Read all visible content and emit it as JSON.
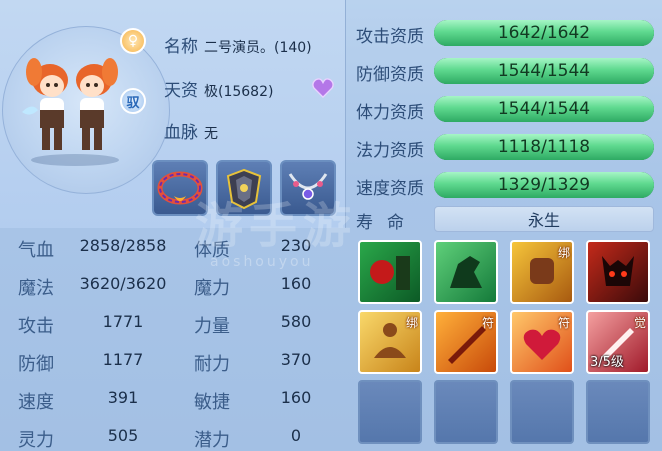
{
  "pet": {
    "name_label": "名称",
    "name_value": "二号演员。(140)",
    "talent_label": "天资",
    "talent_value": "极(15682)",
    "bloodline_label": "血脉",
    "bloodline_value": "无",
    "gender_badge": "♀",
    "tame_badge": "驭"
  },
  "stats": [
    {
      "label": "气血",
      "value": "2858/2858",
      "label2": "体质",
      "value2": "230"
    },
    {
      "label": "魔法",
      "value": "3620/3620",
      "label2": "魔力",
      "value2": "160"
    },
    {
      "label": "攻击",
      "value": "1771",
      "label2": "力量",
      "value2": "580"
    },
    {
      "label": "防御",
      "value": "1177",
      "label2": "耐力",
      "value2": "370"
    },
    {
      "label": "速度",
      "value": "391",
      "label2": "敏捷",
      "value2": "160"
    },
    {
      "label": "灵力",
      "value": "505",
      "label2": "潜力",
      "value2": "0"
    }
  ],
  "aptitudes": [
    {
      "label": "攻击资质",
      "text": "1642/1642",
      "fill": 1.0
    },
    {
      "label": "防御资质",
      "text": "1544/1544",
      "fill": 1.0
    },
    {
      "label": "体力资质",
      "text": "1544/1544",
      "fill": 1.0
    },
    {
      "label": "法力资质",
      "text": "1118/1118",
      "fill": 1.0
    },
    {
      "label": "速度资质",
      "text": "1329/1329",
      "fill": 1.0
    }
  ],
  "life": {
    "label": "寿命",
    "value": "永生"
  },
  "skills": [
    {
      "tag": "",
      "level": ""
    },
    {
      "tag": "",
      "level": ""
    },
    {
      "tag": "绑",
      "level": ""
    },
    {
      "tag": "",
      "level": ""
    },
    {
      "tag": "绑",
      "level": ""
    },
    {
      "tag": "符",
      "level": ""
    },
    {
      "tag": "符",
      "level": ""
    },
    {
      "tag": "觉",
      "level": "3/5级"
    }
  ],
  "watermark": {
    "main": "游手游",
    "sub": "aoshouyou"
  },
  "colors": {
    "bar_fill": "#5fd98f",
    "background": "#a9c5e8"
  }
}
